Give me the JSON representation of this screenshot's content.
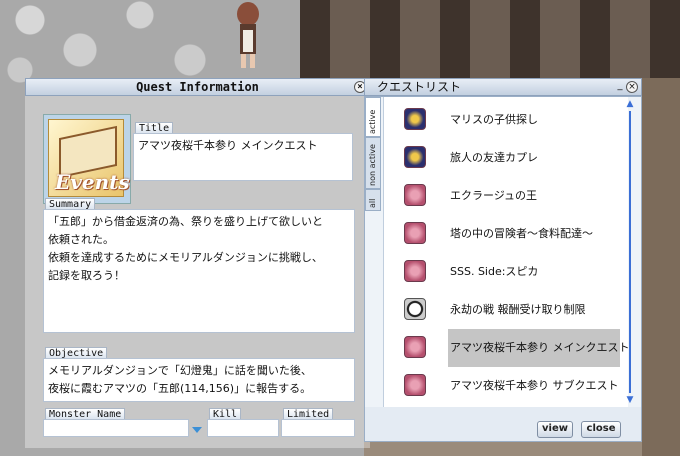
{
  "quest_info": {
    "window_title": "Quest Information",
    "icon_text": "Events",
    "title_label": "Title",
    "title_value": "アマツ夜桜千本参り メインクエスト",
    "summary_label": "Summary",
    "summary_text": "「五郎」から借金返済の為、祭りを盛り上げて欲しいと\n依頼された。\n依頼を達成するためにメモリアルダンジョンに挑戦し、\n記録を取ろう！",
    "objective_label": "Objective",
    "objective_lines": [
      "メモリアルダンジョンで「幻燈鬼」に話を聞いた後、",
      "夜桜に霞むアマツの「五郎(114,156)」に報告する。"
    ],
    "monster_name_label": "Monster Name",
    "kill_label": "Kill",
    "limited_label": "Limited",
    "close_symbol": "×"
  },
  "quest_list": {
    "window_title": "クエストリスト",
    "minimize_symbol": "_",
    "close_symbol": "×",
    "tabs": [
      "active",
      "non active",
      "all"
    ],
    "items": [
      {
        "name": "マリスの子供探し",
        "icon": "navy-quest-icon"
      },
      {
        "name": "旅人の友達カプレ",
        "icon": "navy-quest-icon"
      },
      {
        "name": "エクラージュの王",
        "icon": "pink-quest-icon"
      },
      {
        "name": "塔の中の冒険者～食料配達～",
        "icon": "pink-quest-icon"
      },
      {
        "name": "SSS. Side:スピカ",
        "icon": "pink-quest-icon"
      },
      {
        "name": "永劫の戦 報酬受け取り制限",
        "icon": "clock-quest-icon"
      },
      {
        "name": "アマツ夜桜千本参り メインクエスト",
        "icon": "pink-quest-icon",
        "selected": true
      },
      {
        "name": "アマツ夜桜千本参り サブクエスト",
        "icon": "pink-quest-icon"
      }
    ],
    "view_button": "view",
    "close_button": "close"
  },
  "colors": {
    "titlebar": "#c3d0e0",
    "scrollbar": "#3b6fd6",
    "selection": "#c5c5c5"
  }
}
